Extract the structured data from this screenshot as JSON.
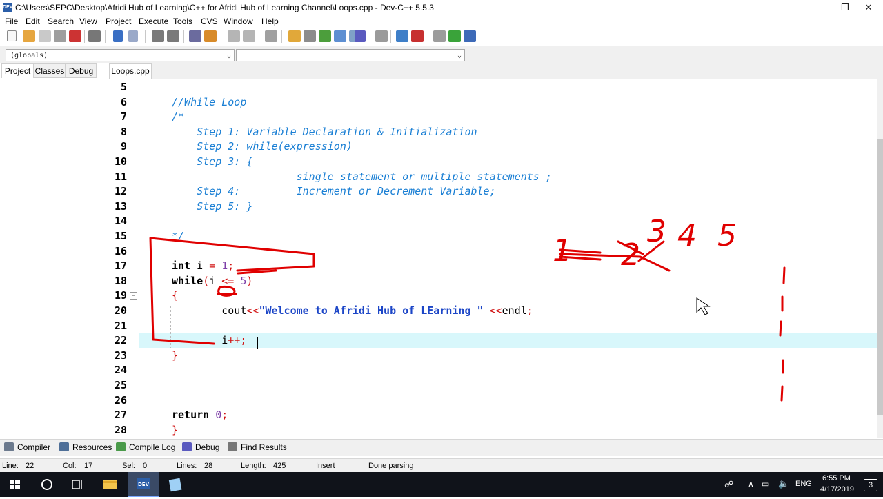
{
  "window": {
    "title": "C:\\Users\\SEPC\\Desktop\\Afridi Hub of Learning\\C++ for Afridi Hub of Learning Channel\\Loops.cpp - Dev-C++ 5.5.3",
    "app_icon_text": "DEV",
    "minimize": "—",
    "restore": "❐",
    "close": "✕"
  },
  "menu": [
    "File",
    "Edit",
    "Search",
    "View",
    "Project",
    "Execute",
    "Tools",
    "CVS",
    "Window",
    "Help"
  ],
  "combo": {
    "left_value": "(globals)",
    "right_value": "",
    "arrow": "⌄"
  },
  "left_panel": {
    "tabs": [
      "Project",
      "Classes",
      "Debug"
    ]
  },
  "editor": {
    "file_tab": "Loops.cpp",
    "fold_marker": "−",
    "lines": [
      {
        "n": "5",
        "parts": []
      },
      {
        "n": "6",
        "parts": [
          {
            "t": "//While Loop",
            "c": "cmt"
          }
        ]
      },
      {
        "n": "7",
        "parts": [
          {
            "t": "/*",
            "c": "cmt"
          }
        ]
      },
      {
        "n": "8",
        "parts": [
          {
            "t": "    Step 1: Variable Declaration & Initialization",
            "c": "cmt"
          }
        ]
      },
      {
        "n": "9",
        "parts": [
          {
            "t": "    Step 2: while(expression)",
            "c": "cmt"
          }
        ]
      },
      {
        "n": "10",
        "parts": [
          {
            "t": "    Step 3: {",
            "c": "cmt"
          }
        ]
      },
      {
        "n": "11",
        "parts": [
          {
            "t": "                    single statement or multiple statements ;",
            "c": "cmt"
          }
        ]
      },
      {
        "n": "12",
        "parts": [
          {
            "t": "    Step 4:         Increment or Decrement Variable;",
            "c": "cmt"
          }
        ]
      },
      {
        "n": "13",
        "parts": [
          {
            "t": "    Step 5: }",
            "c": "cmt"
          }
        ]
      },
      {
        "n": "14",
        "parts": []
      },
      {
        "n": "15",
        "parts": [
          {
            "t": "*/",
            "c": "cmt"
          }
        ]
      },
      {
        "n": "16",
        "parts": []
      },
      {
        "n": "17",
        "parts": [
          {
            "t": "int",
            "c": "kw"
          },
          {
            "t": " i ",
            "c": ""
          },
          {
            "t": "=",
            "c": "sym"
          },
          {
            "t": " ",
            "c": ""
          },
          {
            "t": "1",
            "c": "num"
          },
          {
            "t": ";",
            "c": "sym"
          }
        ]
      },
      {
        "n": "18",
        "parts": [
          {
            "t": "while",
            "c": "kw"
          },
          {
            "t": "(",
            "c": "sym"
          },
          {
            "t": "i ",
            "c": ""
          },
          {
            "t": "<=",
            "c": "sym"
          },
          {
            "t": " ",
            "c": ""
          },
          {
            "t": "5",
            "c": "num"
          },
          {
            "t": ")",
            "c": "sym"
          }
        ]
      },
      {
        "n": "19",
        "parts": [
          {
            "t": "{",
            "c": "sym"
          }
        ]
      },
      {
        "n": "20",
        "parts": [
          {
            "t": "        cout",
            "c": ""
          },
          {
            "t": "<<",
            "c": "sym"
          },
          {
            "t": "\"Welcome to Afridi Hub of LEarning \"",
            "c": "str"
          },
          {
            "t": " ",
            "c": ""
          },
          {
            "t": "<<",
            "c": "sym"
          },
          {
            "t": "endl",
            "c": ""
          },
          {
            "t": ";",
            "c": "sym"
          }
        ]
      },
      {
        "n": "21",
        "parts": []
      },
      {
        "n": "22",
        "parts": [
          {
            "t": "        i",
            "c": ""
          },
          {
            "t": "++;",
            "c": "sym"
          }
        ]
      },
      {
        "n": "23",
        "parts": [
          {
            "t": "}",
            "c": "sym"
          }
        ]
      },
      {
        "n": "24",
        "parts": []
      },
      {
        "n": "25",
        "parts": []
      },
      {
        "n": "26",
        "parts": []
      },
      {
        "n": "27",
        "parts": [
          {
            "t": "return",
            "c": "kw"
          },
          {
            "t": " ",
            "c": ""
          },
          {
            "t": "0",
            "c": "num"
          },
          {
            "t": ";",
            "c": "sym"
          }
        ]
      },
      {
        "n": "28",
        "parts": [
          {
            "t": "}",
            "c": "sym"
          }
        ]
      }
    ],
    "annotation_text": [
      "1",
      "2",
      "3",
      "4",
      "5"
    ]
  },
  "bottom_tabs": [
    "Compiler",
    "Resources",
    "Compile Log",
    "Debug",
    "Find Results"
  ],
  "status": {
    "line_label": "Line:",
    "line": "22",
    "col_label": "Col:",
    "col": "17",
    "sel_label": "Sel:",
    "sel": "0",
    "lines_label": "Lines:",
    "lines": "28",
    "length_label": "Length:",
    "length": "425",
    "mode": "Insert",
    "message": "Done parsing"
  },
  "taskbar": {
    "language": "ENG",
    "time": "6:55 PM",
    "date": "4/17/2019",
    "notification_count": "3"
  },
  "colors": {
    "comment": "#1a7fd4",
    "string": "#1c46c7",
    "symbol": "#d01010",
    "number": "#7d3fa8",
    "current_line": "#d8f7fb",
    "annotation": "#e00000"
  }
}
